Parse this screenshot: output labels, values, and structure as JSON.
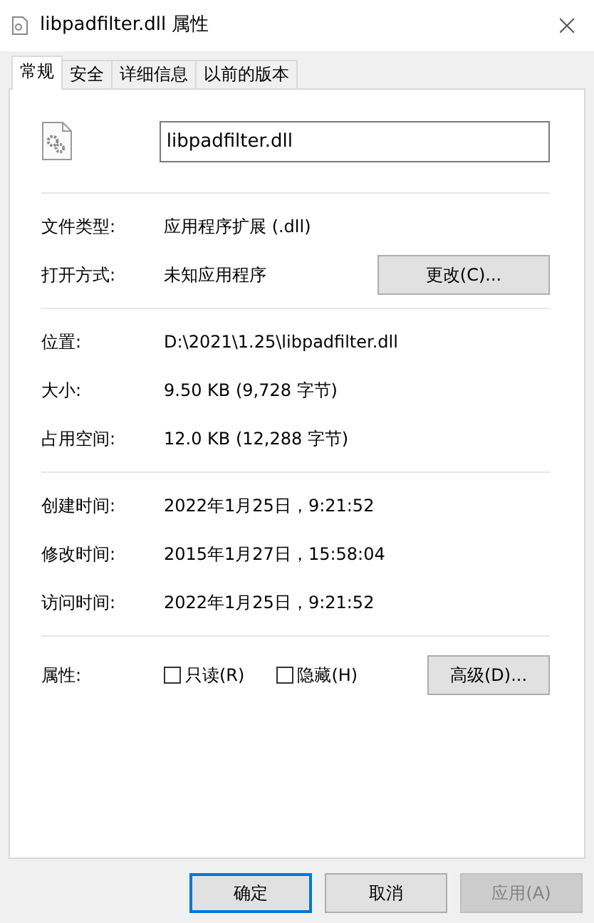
{
  "window": {
    "title": "libpadfilter.dll 属性"
  },
  "tabs": [
    {
      "label": "常规",
      "selected": true
    },
    {
      "label": "安全",
      "selected": false
    },
    {
      "label": "详细信息",
      "selected": false
    },
    {
      "label": "以前的版本",
      "selected": false
    }
  ],
  "file_name": {
    "value": "libpadfilter.dll"
  },
  "sections": [
    {
      "rows": [
        {
          "label": "文件类型:",
          "value": "应用程序扩展 (.dll)"
        },
        {
          "label": "打开方式:",
          "value": "未知应用程序",
          "button": "更改(C)..."
        }
      ]
    },
    {
      "rows": [
        {
          "label": "位置:",
          "value": "D:\\2021\\1.25\\libpadfilter.dll"
        },
        {
          "label": "大小:",
          "value": "9.50 KB (9,728 字节)"
        },
        {
          "label": "占用空间:",
          "value": "12.0 KB (12,288 字节)"
        }
      ]
    },
    {
      "rows": [
        {
          "label": "创建时间:",
          "value": "2022年1月25日，9:21:52"
        },
        {
          "label": "修改时间:",
          "value": "2015年1月27日，15:58:04"
        },
        {
          "label": "访问时间:",
          "value": "2022年1月25日，9:21:52"
        }
      ]
    }
  ],
  "attributes": {
    "label": "属性:",
    "checkboxes": [
      {
        "label": "只读(R)",
        "checked": false
      },
      {
        "label": "隐藏(H)",
        "checked": false
      }
    ],
    "button": "高级(D)..."
  },
  "buttons": [
    {
      "label": "确定",
      "kind": "default",
      "disabled": false
    },
    {
      "label": "取消",
      "kind": "normal",
      "disabled": false
    },
    {
      "label": "应用(A)",
      "kind": "normal",
      "disabled": true
    }
  ]
}
